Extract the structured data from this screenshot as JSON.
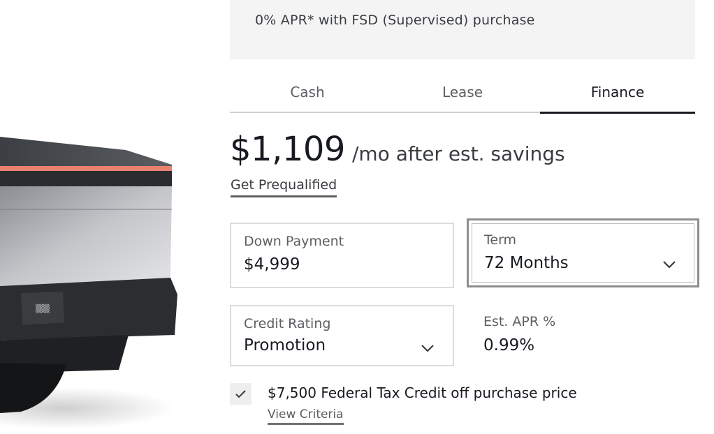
{
  "promo": {
    "text": "0% APR* with FSD (Supervised) purchase"
  },
  "tabs": [
    {
      "label": "Cash",
      "active": false
    },
    {
      "label": "Lease",
      "active": false
    },
    {
      "label": "Finance",
      "active": true
    }
  ],
  "price": {
    "amount": "$1,109",
    "suffix": "/mo after est. savings",
    "prequal_link": "Get Prequalified"
  },
  "fields": {
    "down_payment": {
      "label": "Down Payment",
      "value": "$4,999"
    },
    "term": {
      "label": "Term",
      "value": "72 Months",
      "icon": "chevron-down-icon"
    },
    "credit_rating": {
      "label": "Credit Rating",
      "value": "Promotion",
      "icon": "chevron-down-icon"
    },
    "apr": {
      "label": "Est. APR %",
      "value": "0.99%"
    }
  },
  "tax_credit": {
    "checked": true,
    "icon": "checkmark-icon",
    "label": "$7,500 Federal Tax Credit off purchase price",
    "criteria_link": "View Criteria"
  },
  "colors": {
    "text_primary": "#171a20",
    "text_secondary": "#5c5e62",
    "promo_background": "#f4f4f4",
    "tail_light": "#e8826e"
  }
}
